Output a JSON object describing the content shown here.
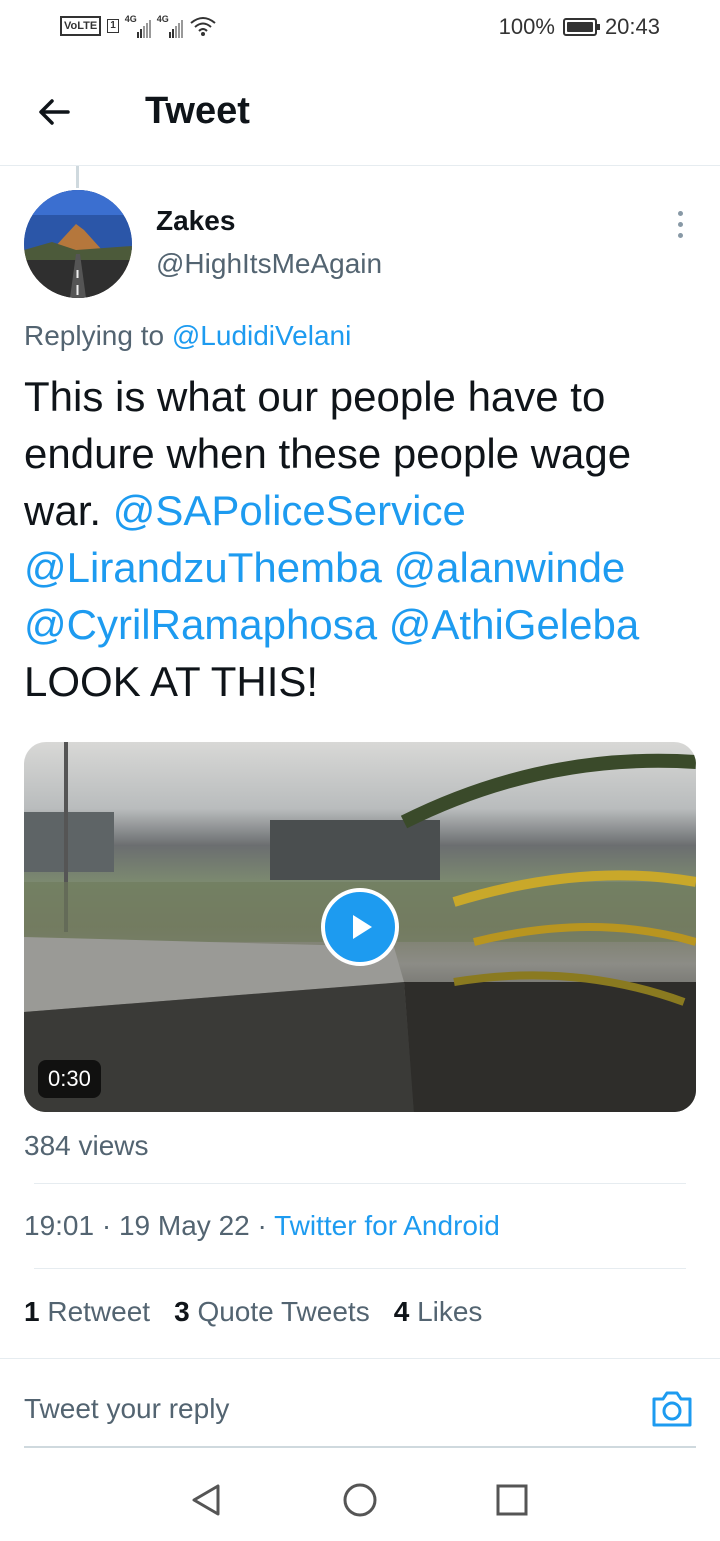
{
  "status_bar": {
    "network_badge": "VoLTE",
    "sim": "1",
    "signal1_label": "4G",
    "signal2_label": "4G",
    "battery_percent": "100%",
    "time": "20:43"
  },
  "header": {
    "title": "Tweet"
  },
  "tweet": {
    "author_name": "Zakes",
    "author_handle": "@HighItsMeAgain",
    "replying_prefix": "Replying to",
    "replying_to": "@LudidiVelani",
    "text_parts": [
      {
        "text": "This is what our people have to endure when these people wage war. ",
        "type": "text"
      },
      {
        "text": "@SAPoliceService",
        "type": "mention"
      },
      {
        "text": " ",
        "type": "text"
      },
      {
        "text": "@LirandzuThemba",
        "type": "mention"
      },
      {
        "text": " ",
        "type": "text"
      },
      {
        "text": "@alanwinde",
        "type": "mention"
      },
      {
        "text": " ",
        "type": "text"
      },
      {
        "text": "@CyrilRamaphosa",
        "type": "mention"
      },
      {
        "text": " ",
        "type": "text"
      },
      {
        "text": "@AthiGeleba",
        "type": "mention"
      },
      {
        "text": " LOOK AT THIS!",
        "type": "text"
      }
    ],
    "video_duration": "0:30",
    "views": "384 views",
    "time": "19:01",
    "date": "19 May 22",
    "source": "Twitter for Android",
    "separator": "·",
    "retweets_count": "1",
    "retweets_label": "Retweet",
    "quotes_count": "3",
    "quotes_label": "Quote Tweets",
    "likes_count": "4",
    "likes_label": "Likes"
  },
  "reply": {
    "placeholder": "Tweet your reply"
  },
  "colors": {
    "accent": "#1d9bf0",
    "text": "#0f1419",
    "secondary": "#536471"
  }
}
